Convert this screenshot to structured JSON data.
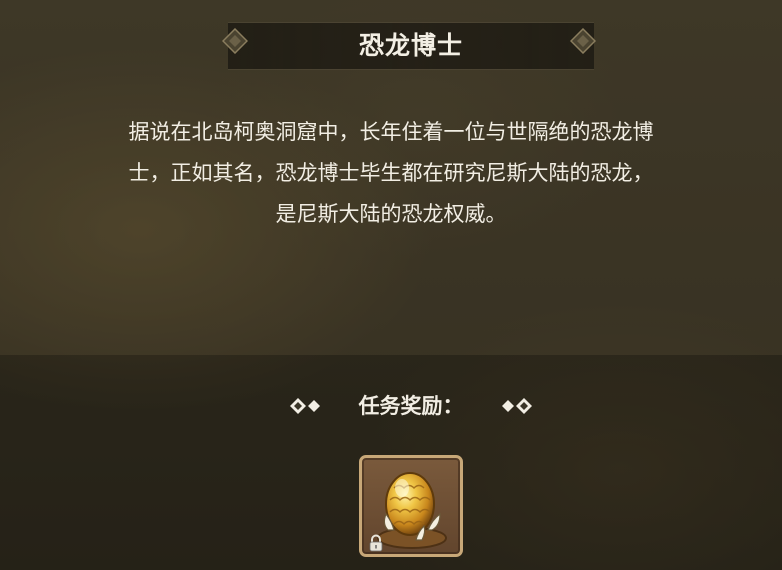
{
  "quest": {
    "title": "恐龙博士",
    "description_lines": [
      "据说在北岛柯奥洞窟中，长年住着一位与世隔绝的恐龙博",
      "士，正如其名，恐龙博士毕生都在研究尼斯大陆的恐龙，",
      "是尼斯大陆的恐龙权威。"
    ]
  },
  "reward": {
    "label": "任务奖励：",
    "items": [
      {
        "icon": "golden-dinosaur-egg-icon",
        "locked": true
      }
    ]
  },
  "colors": {
    "text": "#f2eee4",
    "slot_border": "#c8a878",
    "slot_bg": "#6e4f34",
    "egg_gold": "#e3b33a"
  }
}
